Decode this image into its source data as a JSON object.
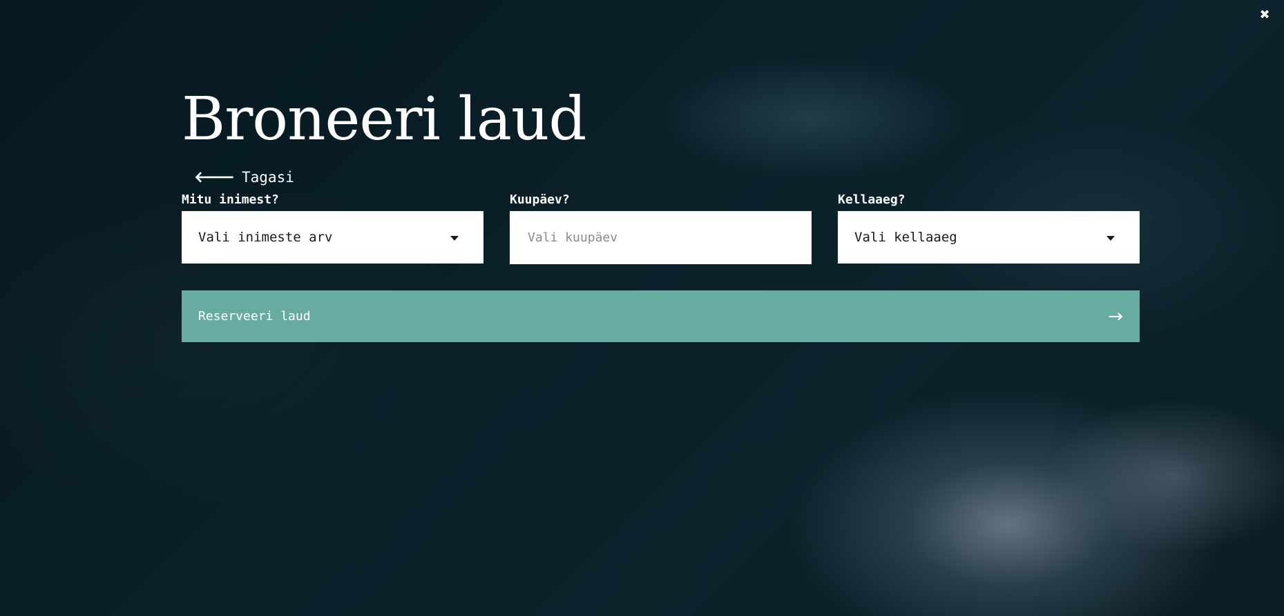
{
  "modal": {
    "close_symbol": "✖",
    "title": "Broneeri laud",
    "back": {
      "icon": "arrow-left-icon",
      "symbol": "🡐",
      "label": "Tagasi"
    }
  },
  "form": {
    "people": {
      "label": "Mitu inimest?",
      "value": "Vali inimeste arv"
    },
    "date": {
      "label": "Kuupäev?",
      "placeholder": "Vali kuupäev"
    },
    "time": {
      "label": "Kellaaeg?",
      "value": "Vali kellaaeg"
    },
    "submit": {
      "label": "Reserveeri laud",
      "arrow_symbol": "→"
    }
  },
  "colors": {
    "accent": "#66aca1",
    "background": "#0a1f28",
    "input_bg": "#ffffff"
  }
}
